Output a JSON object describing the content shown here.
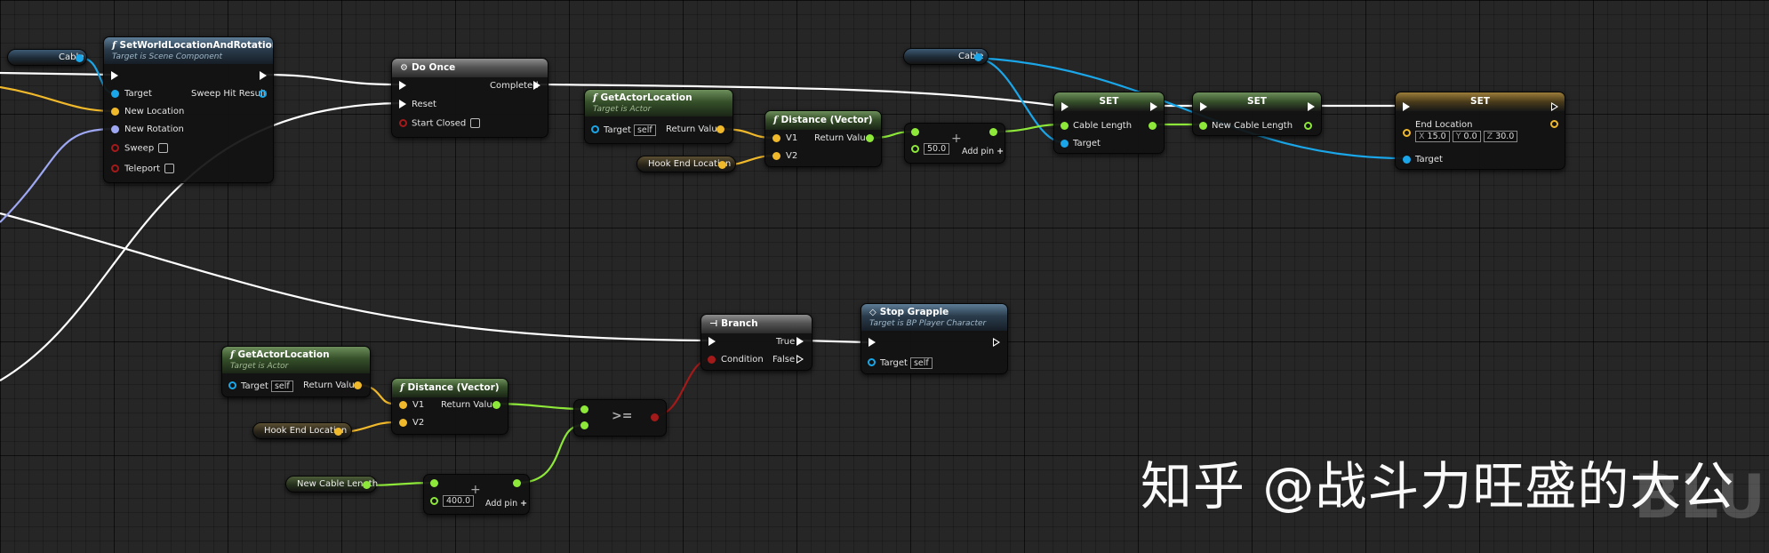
{
  "watermark": {
    "text": "知乎 @战斗力旺盛的大公",
    "faded_text": "BLU"
  },
  "colors": {
    "exec": "#ffffff",
    "object": "#1aa6e8",
    "vector": "#f0b82b",
    "float": "#8ee83a",
    "bool": "#a31a1a",
    "rotator": "#9ea8f2"
  },
  "nodes": {
    "cable_var_1": {
      "label": "Cable"
    },
    "set_world": {
      "title": "SetWorldLocationAndRotation",
      "subtitle": "Target is Scene Component",
      "target": "Target",
      "new_location": "New Location",
      "new_rotation": "New Rotation",
      "sweep": "Sweep",
      "teleport": "Teleport",
      "sweep_hit_result": "Sweep Hit Result"
    },
    "do_once": {
      "title": "Do Once",
      "reset": "Reset",
      "start_closed": "Start Closed",
      "completed": "Completed"
    },
    "get_actor_location_1": {
      "title": "GetActorLocation",
      "subtitle": "Target is Actor",
      "target": "Target",
      "target_value": "self",
      "return_value": "Return Value"
    },
    "hook_end_1": {
      "label": "Hook End Location"
    },
    "distance_1": {
      "title": "Distance (Vector)",
      "v1": "V1",
      "v2": "V2",
      "return_value": "Return Value"
    },
    "add_1": {
      "value": "50.0",
      "add_pin": "Add pin"
    },
    "cable_var_2": {
      "label": "Cable"
    },
    "set_1": {
      "title": "SET",
      "cable_length": "Cable Length",
      "target": "Target"
    },
    "set_2": {
      "title": "SET",
      "new_cable_length": "New Cable Length"
    },
    "set_3": {
      "title": "SET",
      "end_location": "End Location",
      "x_label": "X",
      "x": "15.0",
      "y_label": "Y",
      "y": "0.0",
      "z_label": "Z",
      "z": "30.0",
      "target": "Target"
    },
    "get_actor_location_2": {
      "title": "GetActorLocation",
      "subtitle": "Target is Actor",
      "target": "Target",
      "target_value": "self",
      "return_value": "Return Value"
    },
    "hook_end_2": {
      "label": "Hook End Location"
    },
    "distance_2": {
      "title": "Distance (Vector)",
      "v1": "V1",
      "v2": "V2",
      "return_value": "Return Value"
    },
    "new_cable_length_var": {
      "label": "New Cable Length"
    },
    "add_2": {
      "value": "400.0",
      "add_pin": "Add pin"
    },
    "compare": {
      "op": ">="
    },
    "branch": {
      "title": "Branch",
      "condition": "Condition",
      "true_label": "True",
      "false_label": "False"
    },
    "stop_grapple": {
      "title": "Stop Grapple",
      "subtitle": "Target is BP Player Character",
      "target": "Target",
      "target_value": "self"
    }
  }
}
